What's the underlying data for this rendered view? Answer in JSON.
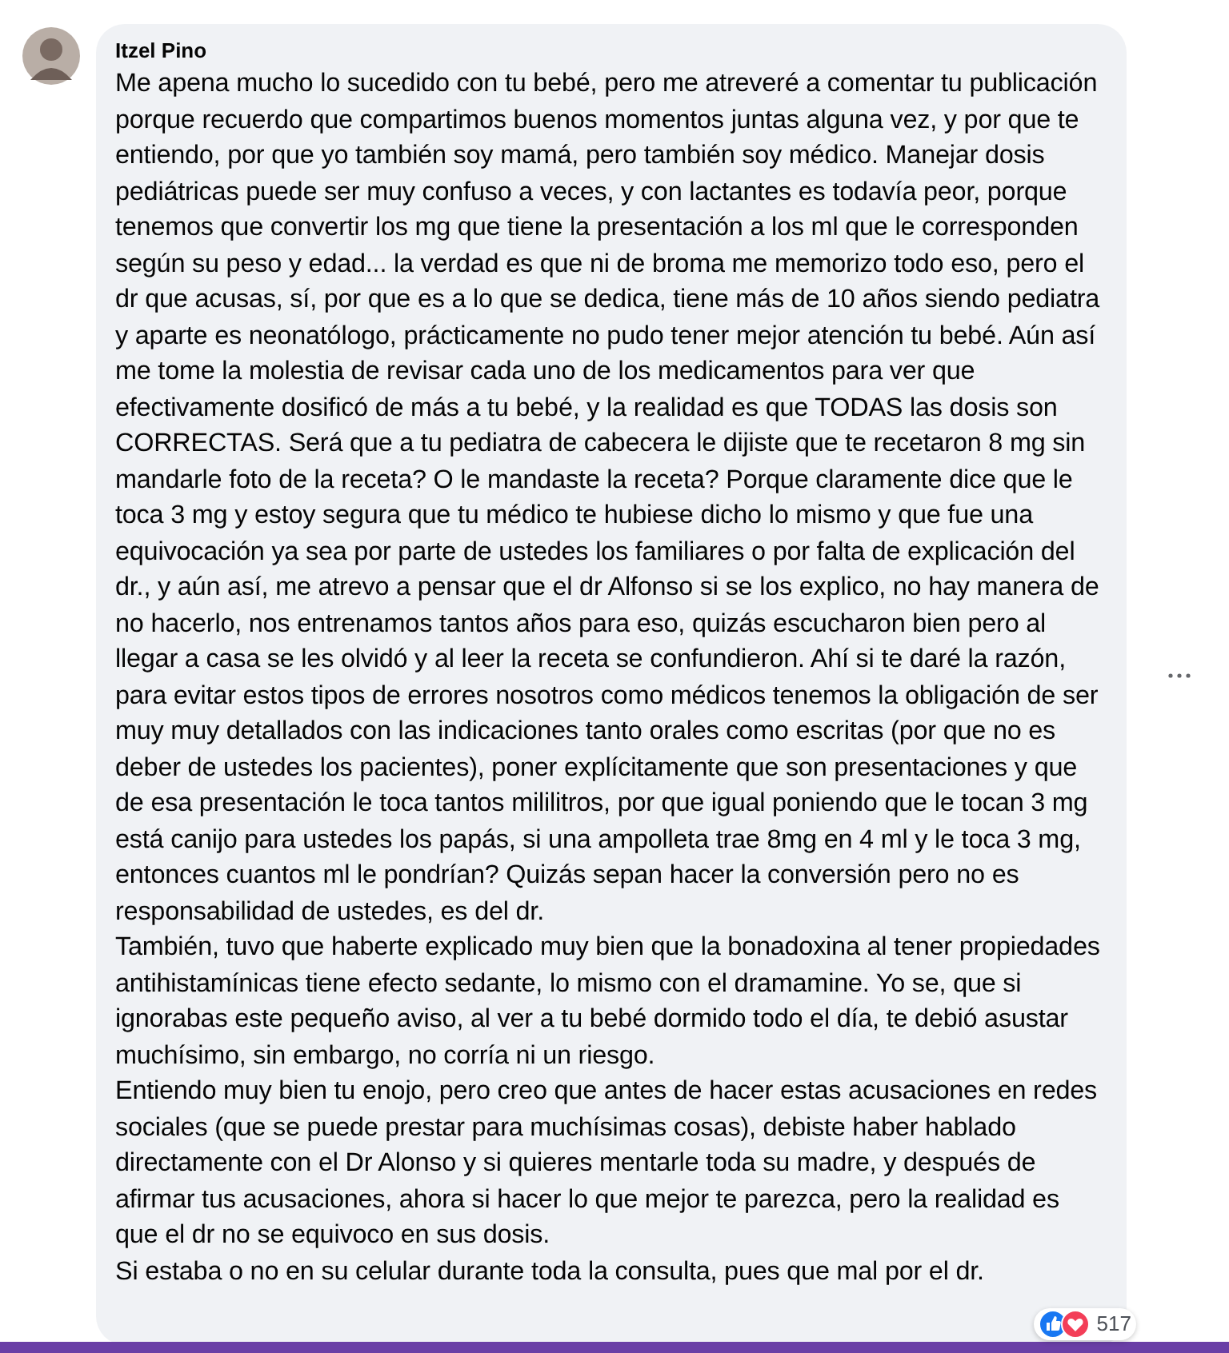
{
  "comment": {
    "author": "Itzel Pino",
    "paragraphs": [
      "Me apena mucho lo sucedido con tu bebé, pero me atreveré a comentar tu publicación porque recuerdo que compartimos buenos momentos juntas alguna vez, y por que te entiendo, por que yo también soy mamá, pero también soy médico. Manejar dosis pediátricas puede ser muy confuso a veces, y con lactantes es todavía peor, porque tenemos que convertir los mg que tiene la presentación a los ml que le corresponden según su peso y edad... la verdad es que ni de broma me memorizo todo eso, pero el dr que acusas, sí, por que es a lo que se dedica, tiene más de 10 años siendo pediatra y aparte es neonatólogo, prácticamente no pudo tener mejor atención tu bebé. Aún así me tome la molestia de revisar cada uno de los medicamentos para ver que efectivamente dosificó de más a tu bebé, y la realidad es que TODAS las dosis son CORRECTAS. Será que a tu pediatra de cabecera le dijiste que te recetaron 8 mg sin mandarle foto de la receta? O le mandaste la receta? Porque claramente dice que le toca 3 mg y estoy segura que tu médico te hubiese dicho lo mismo y que fue una equivocación ya sea por parte de ustedes los familiares o por falta de explicación del dr., y aún así, me atrevo a pensar que el dr Alfonso si se los explico, no hay manera de no hacerlo, nos entrenamos tantos años para eso, quizás escucharon bien pero al llegar a casa se les olvidó y al leer la receta se confundieron. Ahí si te daré la razón, para evitar estos tipos de errores nosotros como médicos tenemos la obligación de ser muy muy detallados con las indicaciones tanto orales como escritas (por que no es deber de ustedes los pacientes), poner explícitamente que son presentaciones y que de esa presentación le toca tantos mililitros, por que igual poniendo que le tocan 3 mg está canijo para ustedes los papás, si una ampolleta trae 8mg en 4 ml y le toca 3 mg, entonces cuantos ml le pondrían? Quizás sepan hacer la conversión pero no es responsabilidad de ustedes, es del dr.",
      "También, tuvo que haberte explicado muy bien que la bonadoxina al tener propiedades antihistamínicas tiene efecto sedante, lo mismo con el dramamine. Yo se, que si ignorabas este pequeño aviso, al ver a tu bebé dormido todo el día, te debió asustar muchísimo, sin embargo, no corría ni un riesgo.",
      "Entiendo muy bien tu enojo, pero creo que antes de hacer estas acusaciones en redes sociales (que se puede prestar para muchísimas cosas), debiste haber hablado directamente con el Dr Alonso y si quieres mentarle toda su madre, y después de afirmar tus acusaciones, ahora si hacer lo que mejor te parezca, pero la realidad es que el dr no se equivoco en sus dosis.",
      "Si estaba o no en su celular durante toda la consulta, pues que mal por el dr."
    ],
    "reactions": [
      {
        "kind": "like"
      },
      {
        "kind": "love"
      }
    ],
    "reaction_count": "517"
  }
}
